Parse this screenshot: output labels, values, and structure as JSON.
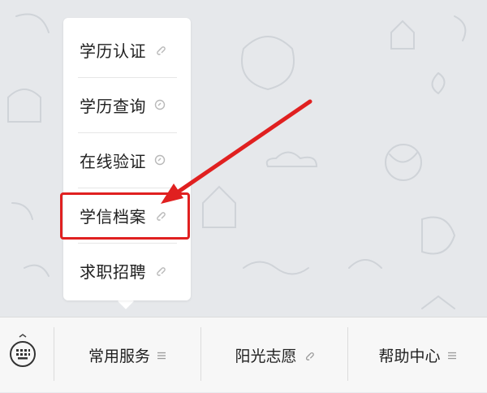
{
  "menu": {
    "items": [
      {
        "label": "学历认证",
        "icon": "link-icon"
      },
      {
        "label": "学历查询",
        "icon": "link-icon"
      },
      {
        "label": "在线验证",
        "icon": "link-icon"
      },
      {
        "label": "学信档案",
        "icon": "link-icon",
        "highlighted": true
      },
      {
        "label": "求职招聘",
        "icon": "link-icon"
      }
    ]
  },
  "bottom_bar": {
    "keyboard_icon": "keyboard-icon",
    "tabs": [
      {
        "label": "常用服务",
        "icon": "menu-lines-icon"
      },
      {
        "label": "阳光志愿",
        "icon": "link-icon"
      },
      {
        "label": "帮助中心",
        "icon": "menu-lines-icon"
      }
    ]
  },
  "colors": {
    "annotation": "#e02020",
    "background": "#e6e8eb"
  }
}
